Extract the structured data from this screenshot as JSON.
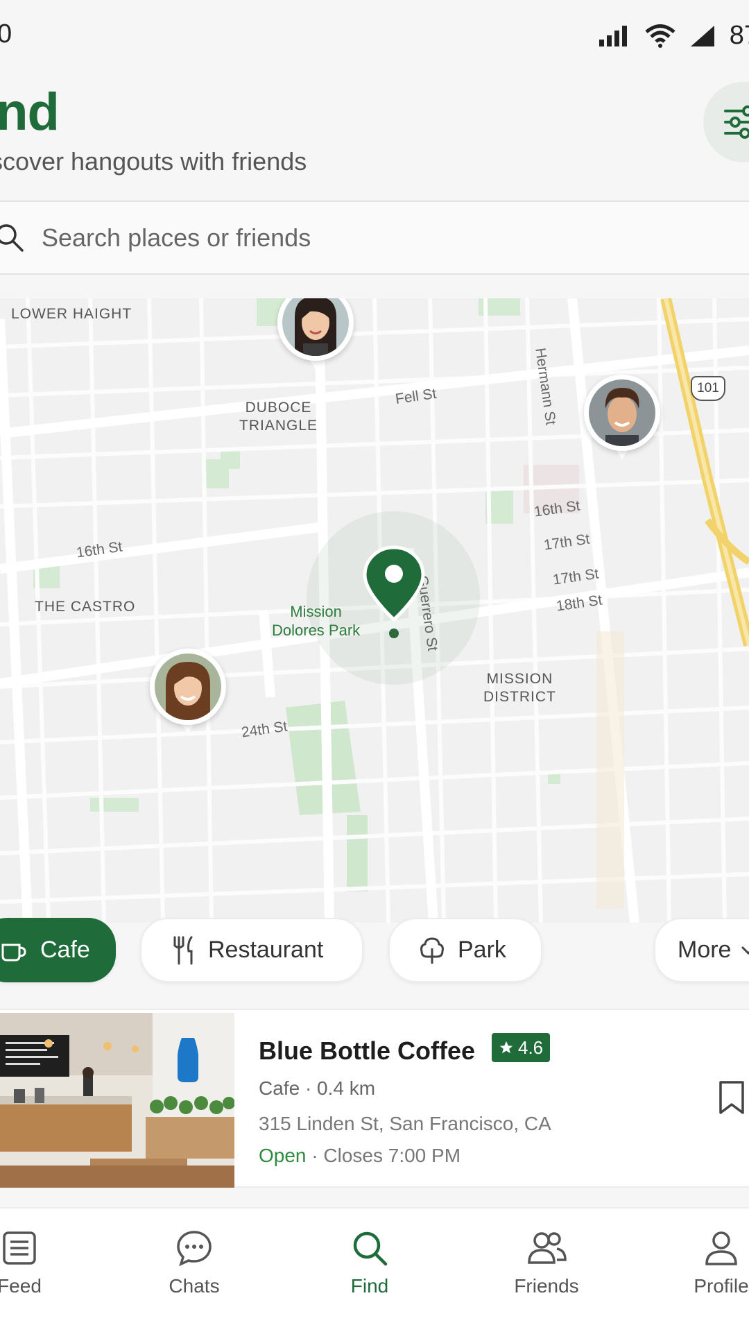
{
  "status": {
    "time": "0",
    "battery": "87"
  },
  "header": {
    "title": "ind",
    "subtitle": "scover hangouts with friends"
  },
  "search": {
    "placeholder": "Search places or friends"
  },
  "map": {
    "areas": {
      "lower_haight": "LOWER HAIGHT",
      "duboce": "DUBOCE\nTRIANGLE",
      "castro": "THE CASTRO",
      "mission": "MISSION\nDISTRICT"
    },
    "streets": {
      "fell": "Fell St",
      "hermann": "Hermann St",
      "sixteenth_east": "16th St",
      "sixteenth_west": "16th St",
      "seventeenth_a": "17th St",
      "seventeenth_b": "17th St",
      "eighteenth": "18th St",
      "guerrero": "Guerrero St",
      "twentyfourth": "24th St"
    },
    "highway": "101",
    "park": "Mission\nDolores Park"
  },
  "chips": [
    "Cafe",
    "Restaurant",
    "Park",
    "More"
  ],
  "place": {
    "name": "Blue Bottle Coffee",
    "rating": "4.6",
    "category": "Cafe",
    "distance": "0.4 km",
    "address": "315 Linden St, San Francisco, CA",
    "status": "Open",
    "closes": "Closes 7:00 PM"
  },
  "nav": [
    "Feed",
    "Chats",
    "Find",
    "Friends",
    "Profile"
  ],
  "colors": {
    "accent": "#1f6b3a",
    "open": "#2e8b3e",
    "highway": "#f2d26a"
  }
}
